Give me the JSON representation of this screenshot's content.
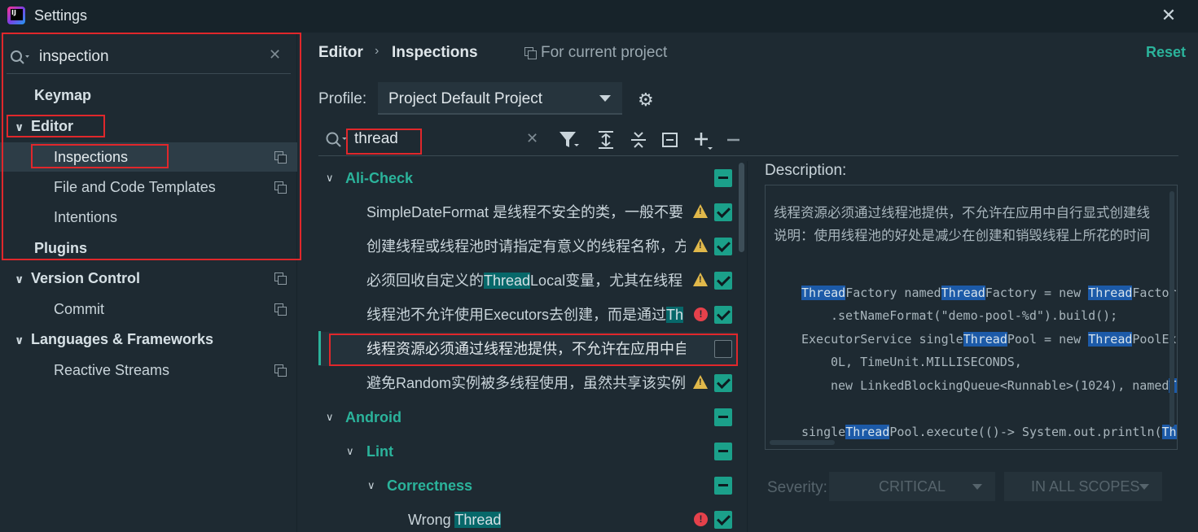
{
  "window": {
    "title": "Settings"
  },
  "sidebar": {
    "search": {
      "value": "inspection"
    },
    "items": [
      {
        "label": "Keymap"
      },
      {
        "label": "Editor"
      },
      {
        "label": "Inspections"
      },
      {
        "label": "File and Code Templates"
      },
      {
        "label": "Intentions"
      },
      {
        "label": "Plugins"
      },
      {
        "label": "Version Control"
      },
      {
        "label": "Commit"
      },
      {
        "label": "Languages & Frameworks"
      },
      {
        "label": "Reactive Streams"
      }
    ]
  },
  "header": {
    "breadcrumb": [
      "Editor",
      "Inspections"
    ],
    "scope": "For current project",
    "reset": "Reset"
  },
  "profile": {
    "label": "Profile:",
    "value": "Project Default  Project"
  },
  "filter": {
    "value": "thread"
  },
  "inspections": [
    {
      "text": "Ali-Check"
    },
    {
      "text": "SimpleDateFormat 是线程不安全的类，一般不要"
    },
    {
      "text": "创建线程或线程池时请指定有意义的线程名称，方"
    },
    {
      "pre": "必须回收自定义的",
      "hl": "Thread",
      "post": "Local变量，尤其在线程"
    },
    {
      "pre": "线程池不允许使用Executors去创建，而是通过",
      "hl": "Th"
    },
    {
      "text": "线程资源必须通过线程池提供，不允许在应用中自"
    },
    {
      "text": "避免Random实例被多线程使用，虽然共享该实例"
    },
    {
      "text": "Android"
    },
    {
      "text": "Lint"
    },
    {
      "text": "Correctness"
    },
    {
      "pre": "Wrong ",
      "hl": "Thread"
    }
  ],
  "description": {
    "label": "Description:",
    "lines": [
      "线程资源必须通过线程池提供，不允许在应用中自行显式创建线",
      "说明：使用线程池的好处是减少在创建和销毁线程上所花的时间"
    ],
    "code": [
      [
        "",
        "Thread",
        "Factory named",
        "Thread",
        "Factory = new ",
        "Thread",
        "Factory"
      ],
      [
        ".setNameFormat(\"demo-pool-%d\").build();"
      ],
      [
        "ExecutorService single",
        "Thread",
        "Pool = new ",
        "Thread",
        "PoolExe"
      ],
      [
        "0L, TimeUnit.MILLISECONDS,"
      ],
      [
        "new LinkedBlockingQueue<Runnable>(1024), named",
        "Th"
      ],
      [
        "single",
        "Thread",
        "Pool.execute(()-> System.out.println(",
        "Thr"
      ]
    ]
  },
  "severity": {
    "label": "Severity:",
    "value": "CRITICAL",
    "scope": "IN ALL SCOPES"
  }
}
